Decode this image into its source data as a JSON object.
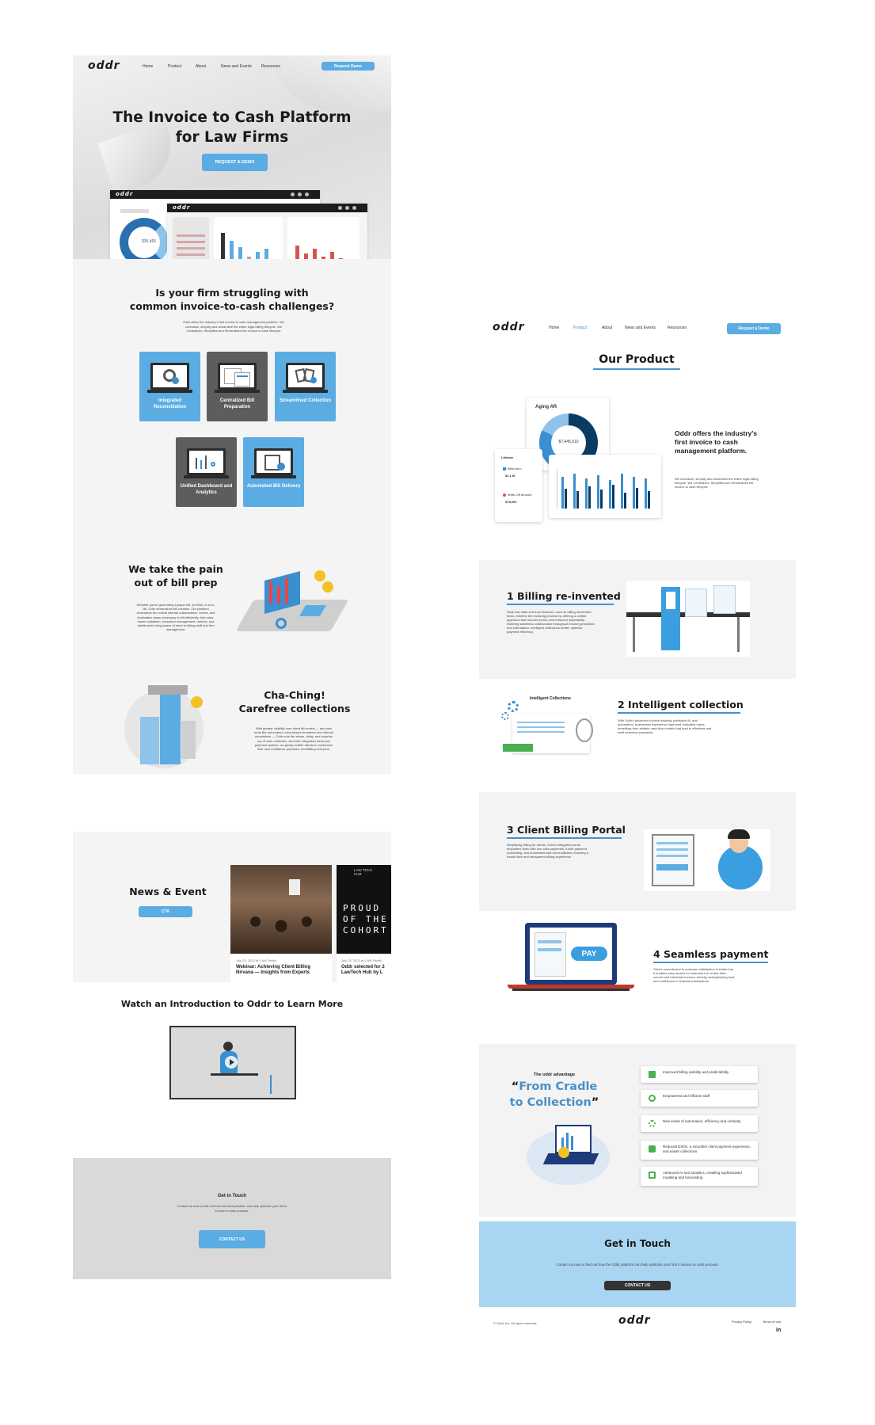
{
  "left_page": {
    "nav": {
      "logo": "oddr",
      "links": [
        "Home",
        "Product",
        "About",
        "News and Events",
        "Resources"
      ],
      "cta": "Request Demo"
    },
    "hero": {
      "title_line1": "The Invoice to Cash Platform",
      "title_line2": "for Law Firms",
      "cta": "REQUEST A DEMO",
      "mock_logo": "oddr",
      "mock_value": "$35,465"
    },
    "struggle": {
      "title_line1": "Is your firm struggling with",
      "title_line2": "common invoice-to-cash challenges?",
      "text": "Oddr offers the industry's first invoice to cash management platform. We centralize, simplify and streamline the entire legal billing lifecycle. We Centralizes, Simplifies and Streamlines the invoice to cash lifecycle",
      "cards": [
        {
          "label": "Integrated Reconciliation",
          "color": "blue"
        },
        {
          "label": "Centralized Bill Preparation",
          "color": "grey"
        },
        {
          "label": "Streamlined Collection",
          "color": "blue"
        },
        {
          "label": "Unified Dashboard and Analytics",
          "color": "grey"
        },
        {
          "label": "Automated Bill Delivery",
          "color": "blue"
        }
      ]
    },
    "pain": {
      "title_line1": "We take the pain",
      "title_line2": "out of bill prep",
      "text": "Whether you're generating a paper bill, an eBill, or an e-bill, Oddr streamlines bill creation. Our platform centralizes the critical internal collaboration, review, and finalization steps necessary to bill efficiently. And rules-based validation, exception management, metrics, and dashboards bring peace of mind to billing staff and firm management."
    },
    "cha_ching": {
      "title_line1": "Cha-Ching!",
      "title_line2": "Carefree collections",
      "text": "With greater visibility over client bill review — and new tools like automated, rules-based reminders and internal escalations — Oddr cuts the stress, delay, and surprise out of cash collection. And with integrated electronic payment options, we gently enable clients to modernize their own remittance practices, benefitting everyone."
    },
    "news": {
      "title": "News & Event",
      "cta": "CTA",
      "items": [
        {
          "date": "July 25, 2023 at 5 AM Pacific",
          "title_line1": "Webinar: Achieving Client Billing",
          "title_line2": "Nirvana — Insights from Experts"
        },
        {
          "date": "July 25, 2023 at 9 AM Pacific",
          "title_line1": "Oddr selected for 2",
          "title_line2": "LawTech Hub by L"
        }
      ],
      "poster_text": [
        "PROUD",
        "OF THE",
        "COHORT"
      ],
      "poster_header": "LAW TECH HUB"
    },
    "video": {
      "title": "Watch an Introduction to Oddr to Learn More"
    },
    "contact": {
      "title": "Get in Touch",
      "text": "Contact us now to find out how the Oddr platform can help optimize your firm's invoice to cash process.",
      "cta": "CONTACT US"
    }
  },
  "right_page": {
    "nav": {
      "logo": "oddr",
      "links": [
        "Home",
        "Product",
        "About",
        "News and Events",
        "Resources"
      ],
      "active": "Product",
      "cta": "Request a Demo"
    },
    "product": {
      "title": "Our Product",
      "aging_label": "Aging AR",
      "donut_value": "$7,445,510",
      "lifetime_label": "Lifetime",
      "billed_label": "Billed Am...",
      "billed_value": "$2.1 M",
      "writeoff_label": "Write-Off Amount",
      "writeoff_value": "$78,000",
      "heading": "Oddr offers the industry's first invoice to cash management platform.",
      "text": "We centralize, simplify and streamline the entire legal billing lifecycle. We Centralizes, Simplifies and Streamlines the invoice to cash lifecycle"
    },
    "features": [
      {
        "title": "1 Billing re-invented",
        "text": "Oddr has state-of-the-art features, such as billing reinvented flows, redefine the invoicing process by offering a unified approach that reduces errors and enhances traceability, fostering seamless collaboration throughout invoice generation and submission. Intelligent collections further optimize payment efficiency."
      },
      {
        "title": "2 Intelligent collection",
        "text": "With Oddr's advanced invoice tracking, predictive AI, and automation, businesses experience improved realization rates, benefiting from reliable cash flow models that lead to effortless and swift seamless payments.",
        "illustration_label": "Intelligent Collections"
      },
      {
        "title": "3 Client Billing Portal",
        "text": "Simplifying billing for clients, Oddr's integrated portal empowers them with one-click payments, future payment scheduling, and automated cash reconciliation, ensuring a hassle-free and transparent billing experience."
      },
      {
        "title": "4 Seamless payment",
        "text": "Oddr's commitment to customer satisfaction is evident as it enables easy access for customers to review both current and historical invoices, thereby strengthening trust and confidence in financial transactions.",
        "pay_label": "PAY"
      }
    ],
    "advantage": {
      "kicker": "The oddr advantage",
      "quote_line1": "From Cradle",
      "quote_line2": "to Collection",
      "items": [
        "Improved billing visibility and predictability",
        "Empowered and efficient staff",
        "New levels of automation, efficiency and certainty",
        "Reduced DSOs, a smoother client payment experience, and easier collections",
        "Advanced AI and analytics, enabling sophisticated modeling and forecasting"
      ]
    },
    "contact": {
      "title": "Get in Touch",
      "text": "Contact us now to find out how the Oddr platform can help optimize your firm's invoice to cash process.",
      "cta": "CONTACT US"
    },
    "footer": {
      "copyright": "© Oddr, Inc. All rights reserved.",
      "logo": "oddr",
      "privacy": "Privacy Policy",
      "terms": "Terms of Use",
      "social": "in"
    }
  },
  "colors": {
    "accent": "#5aace3",
    "dark": "#333333",
    "panel": "#f3f3f3",
    "contact_left": "#d9d9d9",
    "contact_right": "#a8d5f2",
    "chart_red": "#d9534f",
    "chart_navy": "#0b3b63"
  }
}
